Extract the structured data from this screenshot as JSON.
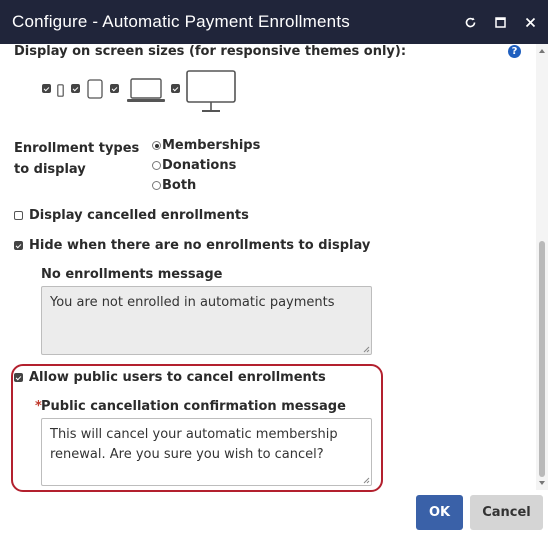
{
  "window": {
    "title": "Configure - Automatic Payment Enrollments",
    "controls": [
      "refresh-icon",
      "maximize-icon",
      "close-icon"
    ]
  },
  "display_sizes": {
    "label": "Display on screen sizes (for responsive themes only):",
    "help": "?",
    "devices": [
      {
        "name": "phone-small",
        "checked": true
      },
      {
        "name": "phone",
        "checked": true
      },
      {
        "name": "tablet",
        "checked": true
      },
      {
        "name": "laptop",
        "checked": true
      },
      {
        "name": "desktop",
        "checked": true
      }
    ]
  },
  "enrollment_types": {
    "label": "Enrollment types to display",
    "options": [
      "Memberships",
      "Donations",
      "Both"
    ],
    "selected": "Memberships"
  },
  "display_cancelled": {
    "label": "Display cancelled enrollments",
    "checked": false
  },
  "hide_when_none": {
    "label": "Hide when there are no enrollments to display",
    "checked": true
  },
  "no_enrollments": {
    "label": "No enrollments message",
    "value": "You are not enrolled in automatic payments"
  },
  "allow_cancel": {
    "label": "Allow public users to cancel enrollments",
    "checked": true
  },
  "cancel_message": {
    "required_marker": "*",
    "label": "Public cancellation confirmation message",
    "value": "This will cancel your automatic membership renewal. Are you sure you wish to cancel?"
  },
  "buttons": {
    "ok": "OK",
    "cancel": "Cancel"
  },
  "colors": {
    "titlebar": "#20253a",
    "highlight": "#b3202e",
    "ok_button": "#3a61a8",
    "cancel_button": "#d5d5d5",
    "help_icon": "#1f5fbf"
  }
}
